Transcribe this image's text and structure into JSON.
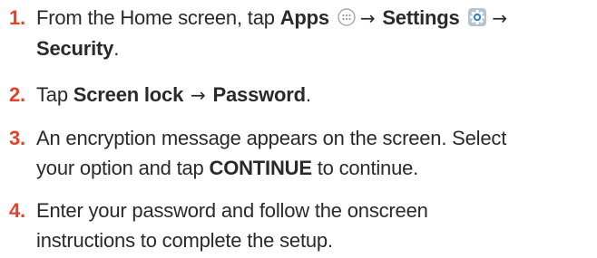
{
  "steps": [
    {
      "number": "1.",
      "intro": "From the Home screen, tap",
      "apps_label": "Apps",
      "arrow": "→",
      "settings_label": "Settings",
      "security_label": "Security",
      "period": ".",
      "icons": [
        "apps-icon",
        "settings-gear-icon"
      ]
    },
    {
      "number": "2.",
      "intro": "Tap",
      "screen_lock_label": "Screen lock",
      "arrow": "→",
      "password_label": "Password",
      "period": "."
    },
    {
      "number": "3.",
      "text_before": "An encryption message appears on the screen.  Select",
      "text_line2_before": "your option and tap",
      "continue_label": "CONTINUE",
      "text_after": "to continue."
    },
    {
      "number": "4.",
      "line1": "Enter your password and follow the onscreen",
      "line2": "instructions to complete the setup."
    }
  ],
  "colors": {
    "step_number": "#e5422b",
    "text": "#2a2a2a"
  }
}
